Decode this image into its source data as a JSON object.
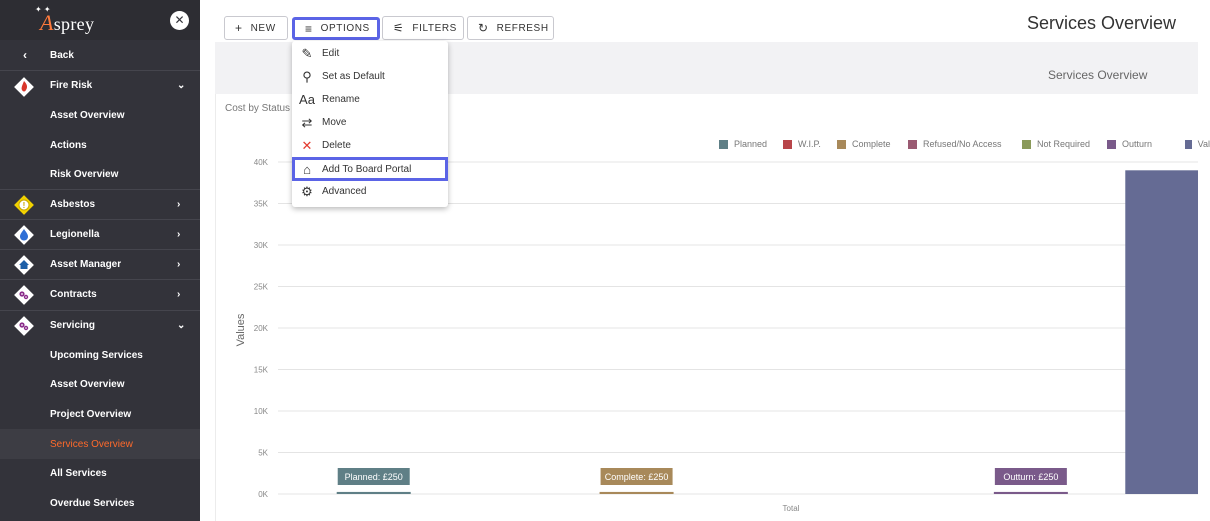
{
  "sidebar": {
    "logo_text": "sprey",
    "logo_letter": "A",
    "back_label": "Back",
    "items": [
      {
        "label": "Fire Risk",
        "icon": "fire-icon",
        "color": "#d9362b",
        "expanded": true
      },
      {
        "label": "Asset Overview"
      },
      {
        "label": "Actions"
      },
      {
        "label": "Risk Overview"
      },
      {
        "label": "Asbestos",
        "icon": "warning-icon",
        "color": "#f2c200"
      },
      {
        "label": "Legionella",
        "icon": "droplet-icon",
        "color": "#2f6fd6"
      },
      {
        "label": "Asset Manager",
        "icon": "house-icon",
        "color": "#1d5fa8"
      },
      {
        "label": "Contracts",
        "icon": "gears-icon",
        "color": "#8a2b8a"
      },
      {
        "label": "Servicing",
        "icon": "gears-icon",
        "color": "#8a2b8a",
        "expanded": true
      },
      {
        "label": "Upcoming Services"
      },
      {
        "label": "Asset Overview"
      },
      {
        "label": "Project Overview"
      },
      {
        "label": "Services Overview",
        "active": true
      },
      {
        "label": "All Services"
      },
      {
        "label": "Overdue Services"
      }
    ]
  },
  "toolbar": {
    "new_label": "NEW",
    "options_label": "OPTIONS",
    "filters_label": "FILTERS",
    "refresh_label": "REFRESH"
  },
  "page_title": "Services Overview",
  "band_title": "Services Overview",
  "chart_heading": "Cost by Status",
  "options_menu": [
    {
      "label": "Edit",
      "icon": "pencil-icon"
    },
    {
      "label": "Set as Default",
      "icon": "pin-icon"
    },
    {
      "label": "Rename",
      "icon": "text-icon",
      "glyph": "Aa"
    },
    {
      "label": "Move",
      "icon": "swap-icon"
    },
    {
      "label": "Delete",
      "icon": "close-icon"
    },
    {
      "label": "Add To Board Portal",
      "icon": "bank-icon",
      "highlighted": true
    },
    {
      "label": "Advanced",
      "icon": "gear-icon"
    }
  ],
  "colors": {
    "accent_highlight": "#5b64e6",
    "sidebar_bg": "#33333a",
    "active_item": "#ff6a2b"
  },
  "chart_data": {
    "type": "bar",
    "ylabel": "Values",
    "xlabel": "Total",
    "ylim": [
      0,
      40000
    ],
    "yticks": [
      "0K",
      "5K",
      "10K",
      "15K",
      "20K",
      "25K",
      "30K",
      "35K",
      "40K"
    ],
    "grid": true,
    "legend_position": "top-right",
    "series": [
      {
        "name": "Planned",
        "value": 250,
        "color": "#5f7f86",
        "label": "Planned: £250"
      },
      {
        "name": "W.I.P.",
        "value": 0,
        "color": "#b8454a"
      },
      {
        "name": "Complete",
        "value": 250,
        "color": "#a8895a",
        "label": "Complete: £250"
      },
      {
        "name": "Refused/No Access",
        "value": 0,
        "color": "#9a5a72"
      },
      {
        "name": "Not Required",
        "value": 0,
        "color": "#8a9a5a"
      },
      {
        "name": "Outturn",
        "value": 250,
        "color": "#7a5a8a",
        "label": "Outturn: £250"
      },
      {
        "name": "Val",
        "value": 39000,
        "color": "#656b94"
      }
    ]
  }
}
